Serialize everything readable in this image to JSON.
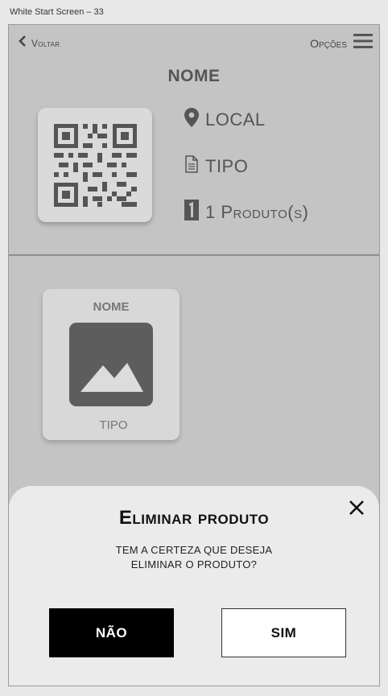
{
  "window": {
    "title": "White Start Screen – 33"
  },
  "nav": {
    "back_label": "Voltar",
    "options_label": "Opções"
  },
  "store": {
    "name": "NOME",
    "location": "LOCAL",
    "type": "TIPO",
    "products_count": "1 Produto(s)"
  },
  "product_card": {
    "name": "NOME",
    "type": "TIPO"
  },
  "dialog": {
    "title": "Eliminar produto",
    "message_line1": "TEM A CERTEZA QUE DESEJA",
    "message_line2": "ELIMINAR O PRODUTO?",
    "no_label": "NÃO",
    "yes_label": "SIM"
  },
  "icons": {
    "back": "chevron-left-icon",
    "menu": "hamburger-menu-icon",
    "qr": "qr-code-icon",
    "location": "map-pin-icon",
    "type": "document-icon",
    "count": "number-one-icon",
    "image": "image-placeholder-icon",
    "close": "close-icon"
  },
  "colors": {
    "frame_bg": "#c4c4c4",
    "dialog_bg": "#ebebeb",
    "primary_button": "#000000"
  }
}
